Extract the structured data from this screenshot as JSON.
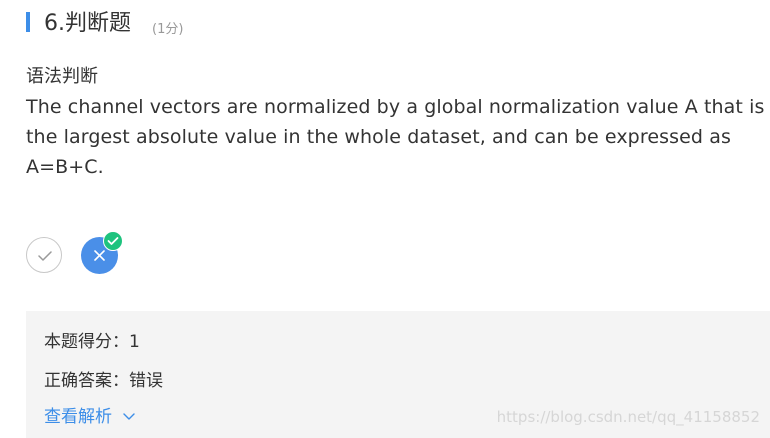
{
  "question": {
    "title": "6.判断题",
    "score": "(1分)",
    "type_label": "语法判断",
    "text": "The channel vectors are normalized by a global normalization value A that is the largest absolute value in the whole dataset, and can be expressed as A=B+C."
  },
  "options": {
    "true_icon": "checkmark-icon",
    "false_icon": "cross-icon",
    "selected": "false",
    "correct_badge_icon": "check-circle-icon"
  },
  "result": {
    "score_line": "本题得分：1",
    "answer_line": "正确答案：错误",
    "analysis_label": "查看解析"
  },
  "watermark": "https://blog.csdn.net/qq_41158852",
  "colors": {
    "accent": "#3d8ee8",
    "selected_option": "#4a8fe8",
    "correct_badge": "#1ec37e",
    "panel_bg": "#f4f4f4"
  }
}
